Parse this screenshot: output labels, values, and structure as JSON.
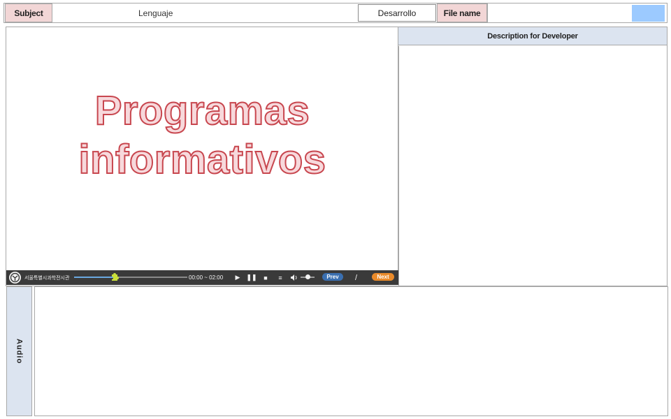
{
  "header": {
    "subject_label": "Subject",
    "subject_value": "Lenguaje",
    "developer_box": "Desarrollo",
    "filename_label": "File name",
    "filename_value": "",
    "swatch_color": "#9ccaff"
  },
  "video": {
    "title_line1": "Programas",
    "title_line2": "informativos"
  },
  "player": {
    "org_name": "서울특별시과학전시관",
    "time": "00:00 ~ 02:00",
    "progress": 0.36,
    "prev_label": "Prev",
    "separator": "/",
    "next_label": "Next"
  },
  "description": {
    "heading": "Description for Developer",
    "body": ""
  },
  "audio": {
    "label": "Audio",
    "body": ""
  }
}
